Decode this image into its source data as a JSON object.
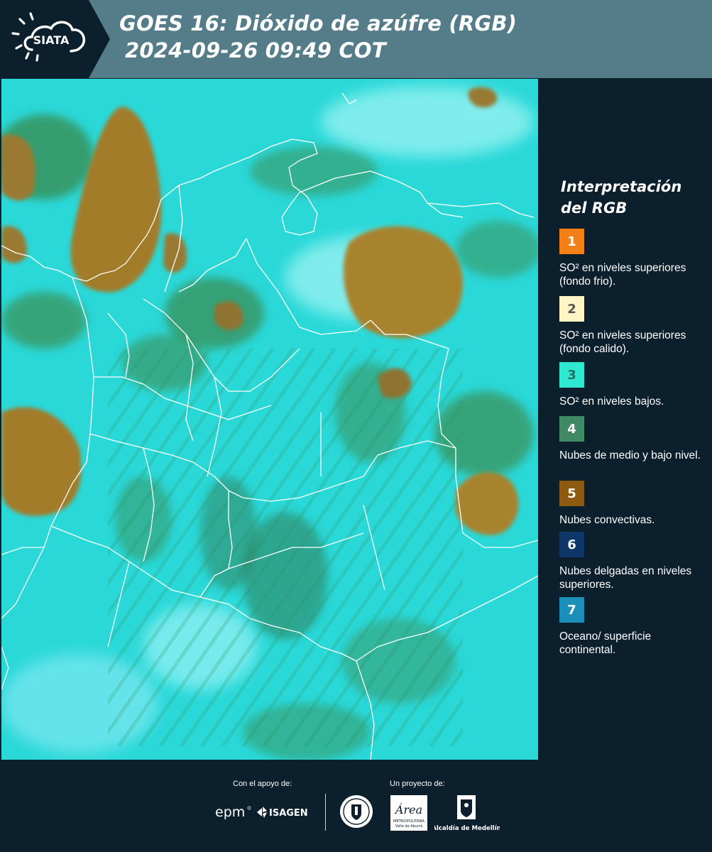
{
  "header": {
    "logo_text": "SIATA",
    "title_line1": "GOES 16: Dióxido de azúfre (RGB)",
    "title_line2": "2024-09-26 09:49 COT"
  },
  "legend": {
    "title_line1": "Interpretación",
    "title_line2": "del RGB",
    "items": [
      {
        "number": "1",
        "color": "#f57f17",
        "text_color": "#ffffff",
        "label": "SO² en niveles superiores (fondo frio)."
      },
      {
        "number": "2",
        "color": "#fff5c4",
        "text_color": "#555555",
        "label": "SO² en niveles superiores (fondo calido)."
      },
      {
        "number": "3",
        "color": "#2ee8cf",
        "text_color": "#2a6d66",
        "label": "SO² en niveles bajos."
      },
      {
        "number": "4",
        "color": "#3f8a64",
        "text_color": "#ffffff",
        "label": "Nubes de medio y bajo nivel."
      },
      {
        "number": "5",
        "color": "#8d5a12",
        "text_color": "#ffffff",
        "label": "Nubes convectivas."
      },
      {
        "number": "6",
        "color": "#0e3768",
        "text_color": "#ffffff",
        "label": "Nubes delgadas en niveles superiores."
      },
      {
        "number": "7",
        "color": "#1c8fb8",
        "text_color": "#ffffff",
        "label": "Oceano/ superficie continental."
      }
    ]
  },
  "footer": {
    "support_label": "Con el apoyo de:",
    "project_label": "Un proyecto de:",
    "logos": {
      "epm": "epm",
      "isagen": "ISAGEN",
      "area": "Área",
      "area_sub": "METROPOLITANA",
      "area_sub2": "Valle de Aburrá",
      "alcaldia": "Alcaldía de Medellín"
    }
  },
  "colors": {
    "header_bg": "#547c89",
    "panel_bg": "#0c1f2d",
    "map_base": "#26d6d6",
    "cloud_convective": "#9c7a2c",
    "cloud_low": "#3a8f55"
  }
}
